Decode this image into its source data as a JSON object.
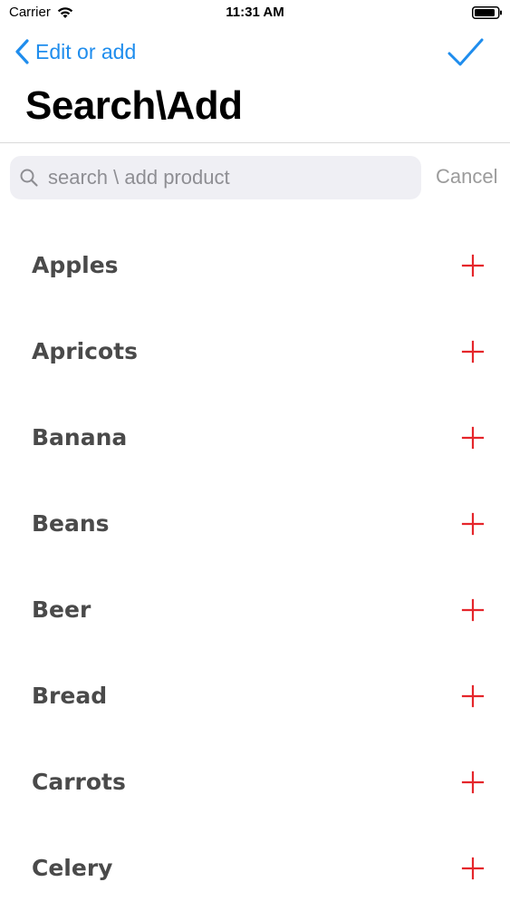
{
  "status_bar": {
    "carrier": "Carrier",
    "time": "11:31 AM"
  },
  "nav": {
    "back_label": "Edit or add",
    "accent_color": "#1f8ded"
  },
  "title": "Search\\Add",
  "search": {
    "placeholder": "search \\ add product",
    "value": "",
    "cancel_label": "Cancel"
  },
  "products": [
    {
      "name": "Apples"
    },
    {
      "name": "Apricots"
    },
    {
      "name": "Banana"
    },
    {
      "name": "Beans"
    },
    {
      "name": "Beer"
    },
    {
      "name": "Bread"
    },
    {
      "name": "Carrots"
    },
    {
      "name": "Celery"
    }
  ],
  "add_icon": "plus-icon",
  "add_icon_color": "#e5262b"
}
